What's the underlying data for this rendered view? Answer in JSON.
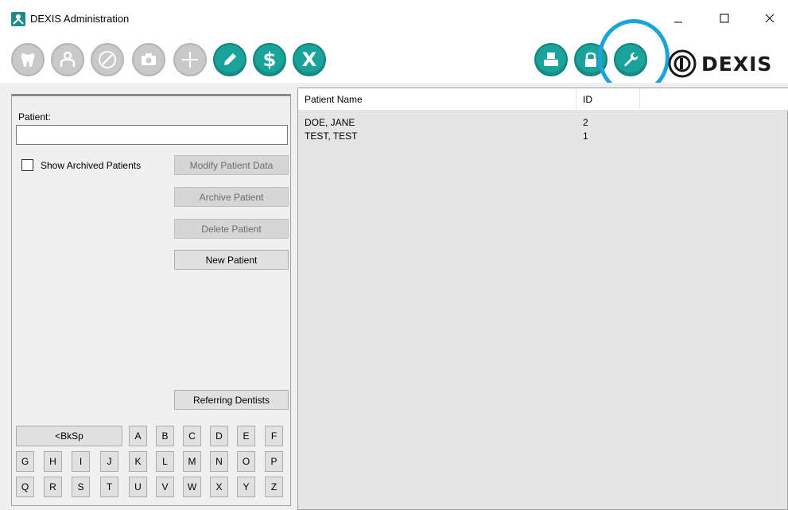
{
  "window": {
    "title": "DEXIS Administration"
  },
  "toolbar": {
    "brand": "DEXIS",
    "buttons": [
      {
        "name": "tooth-icon",
        "state": "disabled"
      },
      {
        "name": "patient-icon",
        "state": "disabled"
      },
      {
        "name": "pencil-slash-icon",
        "state": "disabled"
      },
      {
        "name": "camera-icon",
        "state": "disabled"
      },
      {
        "name": "plus-icon",
        "state": "disabled"
      },
      {
        "name": "edit-pencil-icon",
        "state": "active"
      },
      {
        "name": "dollar-icon",
        "state": "active",
        "glyph": "$"
      },
      {
        "name": "x-icon",
        "state": "active",
        "glyph": "X"
      },
      {
        "name": "printer-icon",
        "state": "active"
      },
      {
        "name": "lock-icon",
        "state": "active"
      },
      {
        "name": "wrench-icon",
        "state": "active",
        "highlighted": true
      }
    ],
    "accent_color": "#1aa39a",
    "highlight_color": "#1ba3dd"
  },
  "left": {
    "patient_label": "Patient:",
    "patient_value": "",
    "show_archived_label": "Show Archived Patients",
    "show_archived_checked": false,
    "modify_label": "Modify Patient Data",
    "archive_label": "Archive Patient",
    "delete_label": "Delete Patient",
    "new_label": "New Patient",
    "referring_label": "Referring Dentists",
    "backspace_label": "<BkSp",
    "keys_row1": [
      "A",
      "B",
      "C",
      "D",
      "E",
      "F"
    ],
    "keys_row2": [
      "G",
      "H",
      "I",
      "J",
      "K",
      "L",
      "M",
      "N",
      "O",
      "P"
    ],
    "keys_row3": [
      "Q",
      "R",
      "S",
      "T",
      "U",
      "V",
      "W",
      "X",
      "Y",
      "Z"
    ]
  },
  "list": {
    "columns": [
      "Patient Name",
      "ID"
    ],
    "rows": [
      {
        "name": "DOE, JANE",
        "id": "2"
      },
      {
        "name": "TEST, TEST",
        "id": "1"
      }
    ]
  }
}
